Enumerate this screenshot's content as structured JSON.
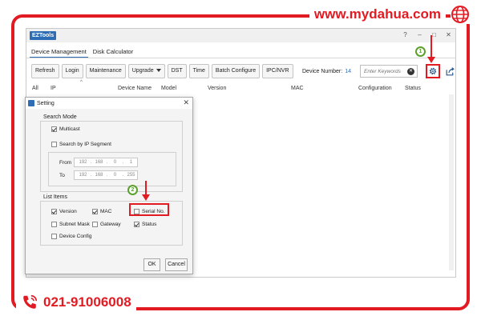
{
  "brand": {
    "url": "www.mydahua.com",
    "phone": "021-91006008",
    "accent": "#e21b23"
  },
  "app": {
    "title": "EZTools",
    "tabs": [
      {
        "label": "Device Management",
        "active": true
      },
      {
        "label": "Disk Calculator",
        "active": false
      }
    ],
    "toolbar": {
      "refresh": "Refresh",
      "login": "Login",
      "maintenance": "Maintenance",
      "upgrade": "Upgrade",
      "dst": "DST",
      "time": "Time",
      "batch_configure": "Batch Configure",
      "ipc_nvr": "IPC/NVR"
    },
    "device_number_label": "Device Number:",
    "device_number": "14",
    "search_placeholder": "Enter Keywords",
    "columns": {
      "all": "All",
      "ip": "IP",
      "device_name": "Device Name",
      "model": "Model",
      "version": "Version",
      "mac": "MAC",
      "configuration": "Configuration",
      "status": "Status"
    }
  },
  "annotations": {
    "step1": "1",
    "step2": "2"
  },
  "dialog": {
    "title": "Setting",
    "search_mode": {
      "label": "Search Mode",
      "multicast": {
        "label": "Multicast",
        "checked": true
      },
      "ip_segment": {
        "label": "Search by IP Segment",
        "checked": false
      },
      "from_label": "From",
      "to_label": "To",
      "from": [
        "192",
        "168",
        "0",
        "1"
      ],
      "to": [
        "192",
        "168",
        "0",
        "255"
      ]
    },
    "list_items": {
      "label": "List Items",
      "version": {
        "label": "Version",
        "checked": true
      },
      "mac": {
        "label": "MAC",
        "checked": true
      },
      "serial_no": {
        "label": "Serial No.",
        "checked": false
      },
      "subnet_mask": {
        "label": "Subnet Mask",
        "checked": false
      },
      "gateway": {
        "label": "Gateway",
        "checked": false
      },
      "status": {
        "label": "Status",
        "checked": true
      },
      "device_config": {
        "label": "Device Config",
        "checked": false
      }
    },
    "ok": "OK",
    "cancel": "Cancel"
  }
}
